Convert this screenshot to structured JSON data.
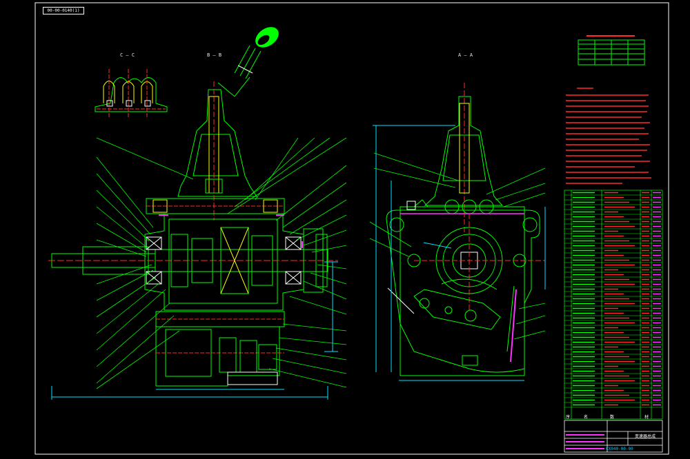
{
  "header": {
    "drawing_code_top": "00-00-0140(1)"
  },
  "views": {
    "view_cc": "C — C",
    "view_bb": "B — B",
    "view_aa": "A — A"
  },
  "bom_header": {
    "col_no": "序",
    "col_name": "名",
    "col_qty": "数",
    "col_mat": "材"
  },
  "title_block": {
    "title": "变速器总成",
    "drawing_no": "CX040-00-00"
  },
  "colors": {
    "background": "#000000",
    "outline": "#00ff00",
    "centerline": "#ff2a2a",
    "hidden": "#ffff00",
    "dimension": "#00e5ff",
    "highlight": "#ff33ff",
    "frame": "#ffffff"
  }
}
